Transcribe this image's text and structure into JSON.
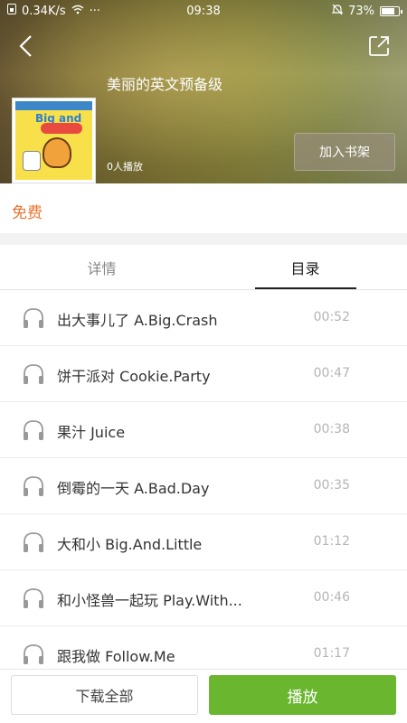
{
  "status_bar": {
    "net_speed": "0.34K/s",
    "more": "···",
    "time": "09:38",
    "battery": "73%"
  },
  "header": {
    "title": "美丽的英文预备级",
    "plays": "0人播放",
    "add_shelf_label": "加入书架",
    "cover_word": "Big and"
  },
  "price": "免费",
  "tabs": [
    {
      "label": "详情",
      "active": false
    },
    {
      "label": "目录",
      "active": true
    }
  ],
  "tracks": [
    {
      "title": "出大事儿了 A.Big.Crash",
      "duration": "00:52"
    },
    {
      "title": "饼干派对 Cookie.Party",
      "duration": "00:47"
    },
    {
      "title": "果汁 Juice",
      "duration": "00:38"
    },
    {
      "title": "倒霉的一天 A.Bad.Day",
      "duration": "00:35"
    },
    {
      "title": "大和小 Big.And.Little",
      "duration": "01:12"
    },
    {
      "title": "和小怪兽一起玩 Play.With...",
      "duration": "00:46"
    },
    {
      "title": "跟我做 Follow.Me",
      "duration": "01:17"
    }
  ],
  "bottom": {
    "download_all_label": "下载全部",
    "play_label": "播放"
  },
  "colors": {
    "accent_orange": "#e9742f",
    "play_green": "#6ab62f"
  }
}
